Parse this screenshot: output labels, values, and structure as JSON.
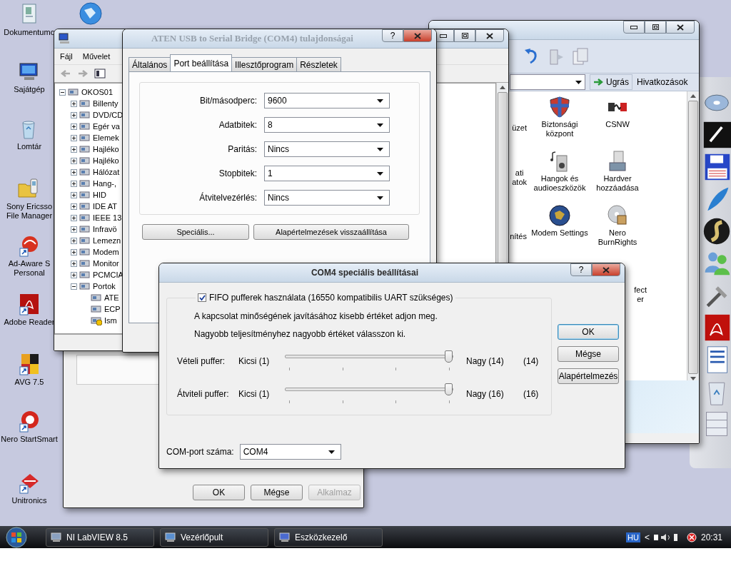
{
  "desktop_icons": [
    {
      "lines": [
        "Dokumentumo"
      ]
    },
    {
      "lines": [
        "Sajátgép"
      ]
    },
    {
      "lines": [
        "Lomtár"
      ]
    },
    {
      "lines": [
        "Sony Ericsso",
        "File Manager"
      ]
    },
    {
      "lines": [
        "Ad-Aware S",
        "Personal"
      ]
    },
    {
      "lines": [
        "Adobe Reader"
      ]
    },
    {
      "lines": [
        "AVG 7.5"
      ]
    },
    {
      "lines": [
        "Nero StartSmart"
      ]
    },
    {
      "lines": [
        "Unitronics"
      ]
    }
  ],
  "device_manager": {
    "menu": [
      "Fájl",
      "Művelet"
    ],
    "tree": {
      "label": "OKOS01",
      "expanded": true,
      "children": [
        {
          "label": "Billenty",
          "expanded": false
        },
        {
          "label": "DVD/CD",
          "expanded": false
        },
        {
          "label": "Egér va",
          "expanded": false
        },
        {
          "label": "Elemek",
          "expanded": false
        },
        {
          "label": "Hajléko",
          "expanded": false
        },
        {
          "label": "Hajléko",
          "expanded": false
        },
        {
          "label": "Hálózat",
          "expanded": false
        },
        {
          "label": "Hang-,",
          "expanded": false
        },
        {
          "label": "HID",
          "expanded": false
        },
        {
          "label": "IDE AT",
          "expanded": false
        },
        {
          "label": "IEEE 13",
          "expanded": false
        },
        {
          "label": "Infravö",
          "expanded": false
        },
        {
          "label": "Lemezn",
          "expanded": false
        },
        {
          "label": "Modem",
          "expanded": false
        },
        {
          "label": "Monitor",
          "expanded": false
        },
        {
          "label": "PCMCIA",
          "expanded": false
        },
        {
          "label": "Portok",
          "expanded": true,
          "children": [
            {
              "label": "ATE",
              "warning": false
            },
            {
              "label": "ECP",
              "warning": false
            },
            {
              "label": "Ism",
              "warning": true
            }
          ]
        }
      ]
    }
  },
  "aten_dialog": {
    "title": "ATEN USB to Serial Bridge (COM4) tulajdonságai",
    "help_button": "?",
    "tabs": [
      {
        "label": "Általános",
        "selected": false
      },
      {
        "label": "Port beállítása",
        "selected": true
      },
      {
        "label": "Illesztőprogram",
        "selected": false
      },
      {
        "label": "Részletek",
        "selected": false
      }
    ],
    "fields": [
      {
        "label": "Bit/másodperc:",
        "value": "9600"
      },
      {
        "label": "Adatbitek:",
        "value": "8"
      },
      {
        "label": "Paritás:",
        "value": "Nincs"
      },
      {
        "label": "Stopbitek:",
        "value": "1"
      },
      {
        "label": "Átvitelvezérlés:",
        "value": "Nincs"
      }
    ],
    "buttons": [
      "Speciális...",
      "Alapértelmezések visszaállítása"
    ]
  },
  "back_dialog": {
    "buttons": [
      {
        "label": "OK",
        "disabled": false
      },
      {
        "label": "Mégse",
        "disabled": false
      },
      {
        "label": "Alkalmaz",
        "disabled": true
      }
    ]
  },
  "control_panel": {
    "go_button": "Ugrás",
    "links": "Hivatkozások",
    "items": [
      {
        "kind": "partial",
        "lines": [
          "üzet"
        ]
      },
      {
        "kind": "full",
        "lines": [
          "Biztonsági",
          "központ"
        ]
      },
      {
        "kind": "full",
        "lines": [
          "CSNW"
        ]
      },
      {
        "kind": "partial",
        "lines": [
          "ati",
          "atok"
        ]
      },
      {
        "kind": "full",
        "lines": [
          "Hangok és",
          "audioeszközök"
        ]
      },
      {
        "kind": "full",
        "lines": [
          "Hardver",
          "hozzáadása"
        ]
      },
      {
        "kind": "partial",
        "lines": [
          "nítés"
        ]
      },
      {
        "kind": "full",
        "lines": [
          "Modem Settings"
        ]
      },
      {
        "kind": "full",
        "lines": [
          "Nero",
          "BurnRights"
        ]
      },
      {
        "kind": "partial-right",
        "lines": [
          "fect",
          "er"
        ]
      }
    ]
  },
  "com4_dialog": {
    "title": "COM4 speciális beállításai",
    "help_button": "?",
    "fifo": {
      "label": "FIFO pufferek használata (16550 kompatibilis UART szükséges)",
      "checked": true
    },
    "hints": [
      "A kapcsolat minőségének javításához kisebb értéket adjon meg.",
      "Nagyobb teljesítményhez nagyobb értéket válasszon ki."
    ],
    "sliders": [
      {
        "label": "Vételi puffer:",
        "min": "Kicsi (1)",
        "max": "Nagy (14)",
        "reading": "(14)",
        "level": 1
      },
      {
        "label": "Átviteli puffer:",
        "min": "Kicsi (1)",
        "max": "Nagy (16)",
        "reading": "(16)",
        "level": 1
      }
    ],
    "port": {
      "label": "COM-port száma:",
      "value": "COM4"
    },
    "buttons": [
      {
        "label": "OK",
        "default": true
      },
      {
        "label": "Mégse",
        "default": false
      },
      {
        "label": "Alapértelmezés",
        "default": false
      }
    ]
  },
  "taskbar": {
    "tasks": [
      {
        "label": "NI LabVIEW 8.5",
        "selected": false
      },
      {
        "label": "Vezérlőpult",
        "selected": false
      },
      {
        "label": "Eszközkezelő",
        "selected": false
      }
    ],
    "language": "HU",
    "tray_arrow": "<",
    "clock": "20:31"
  }
}
